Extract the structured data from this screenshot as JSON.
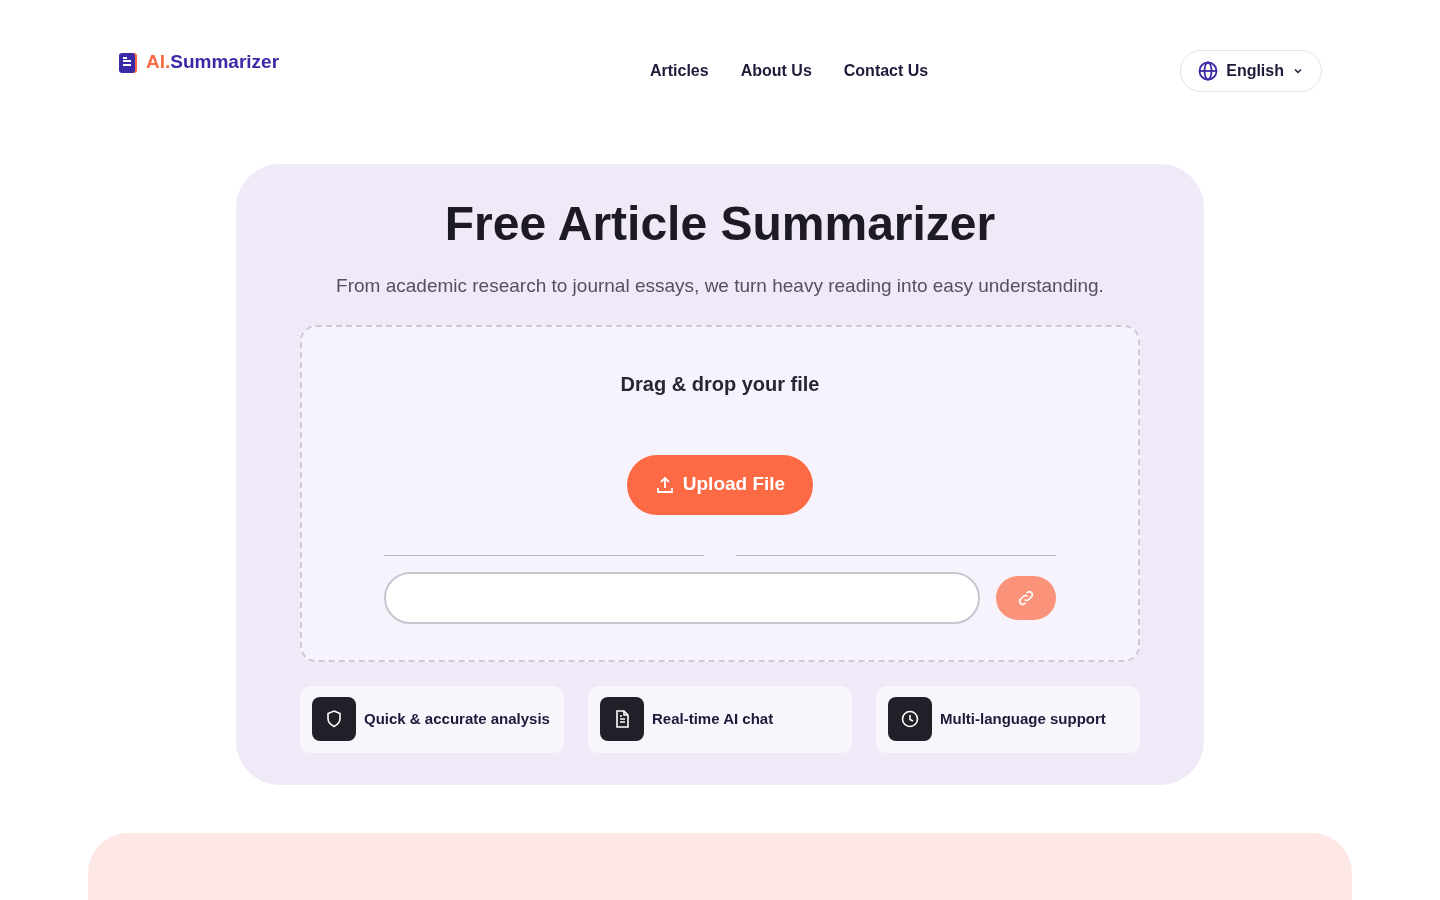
{
  "logo": {
    "prefix": "AI.",
    "name": "Summarizer"
  },
  "nav": [
    "Articles",
    "About Us",
    "Contact Us"
  ],
  "language": {
    "label": "English"
  },
  "hero": {
    "title": "Free Article Summarizer",
    "subtitle": "From academic research to journal essays, we turn heavy reading into easy understanding."
  },
  "upload": {
    "prompt": "Drag & drop your file",
    "button": "Upload File"
  },
  "features": [
    {
      "kind": "shield",
      "label": "Quick & accurate analysis"
    },
    {
      "kind": "document",
      "label": "Real-time AI chat"
    },
    {
      "kind": "clock",
      "label": "Multi-language support"
    }
  ]
}
